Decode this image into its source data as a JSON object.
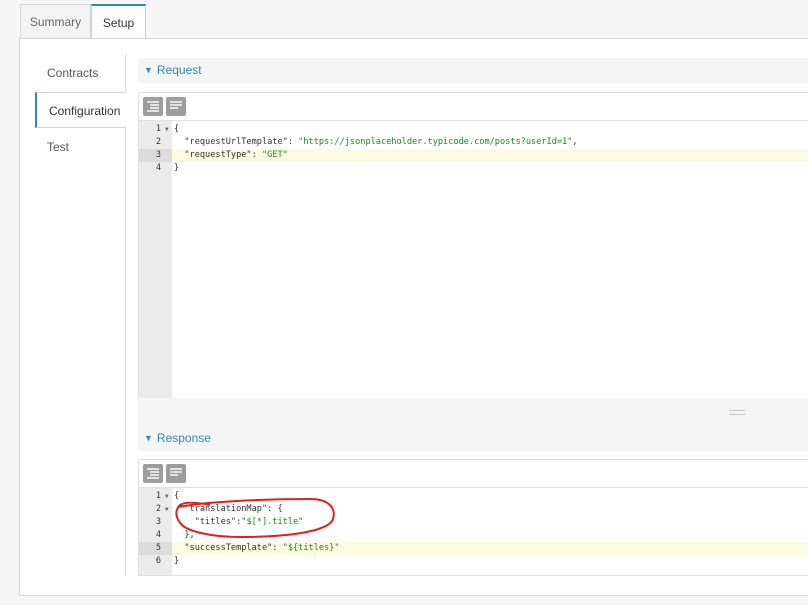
{
  "tabs": [
    {
      "label": "Summary"
    },
    {
      "label": "Setup"
    }
  ],
  "sidebar": {
    "items": [
      {
        "label": "Contracts"
      },
      {
        "label": "Configuration"
      },
      {
        "label": "Test"
      }
    ]
  },
  "request": {
    "header": "Request",
    "lines": [
      {
        "n": "1",
        "fold": true,
        "code": "{"
      },
      {
        "n": "2",
        "fold": false,
        "key": "  \"requestUrlTemplate\": ",
        "val": "\"https://jsonplaceholder.typicode.com/posts?userId=1\"",
        "tail": ","
      },
      {
        "n": "3",
        "fold": false,
        "key": "  \"requestType\": ",
        "val": "\"GET\"",
        "tail": "",
        "highlight": true
      },
      {
        "n": "4",
        "fold": false,
        "code": "}"
      }
    ]
  },
  "response": {
    "header": "Response",
    "lines": [
      {
        "n": "1",
        "fold": true,
        "code": "{"
      },
      {
        "n": "2",
        "fold": true,
        "key": "  \"translationMap\": {",
        "val": "",
        "tail": ""
      },
      {
        "n": "3",
        "fold": false,
        "key": "    \"titles\":",
        "val": "\"$[*].title\"",
        "tail": ""
      },
      {
        "n": "4",
        "fold": false,
        "code": "  },"
      },
      {
        "n": "5",
        "fold": false,
        "key": "  \"successTemplate\": ",
        "val": "\"${titles}\"",
        "tail": "",
        "highlight": true
      },
      {
        "n": "6",
        "fold": false,
        "code": "}"
      }
    ]
  },
  "colors": {
    "accent": "#2a8cb1",
    "string": "#1a8a1a",
    "annotation": "#e02020"
  },
  "icons": {
    "format": "align-left-icon",
    "compact": "align-justify-icon"
  }
}
